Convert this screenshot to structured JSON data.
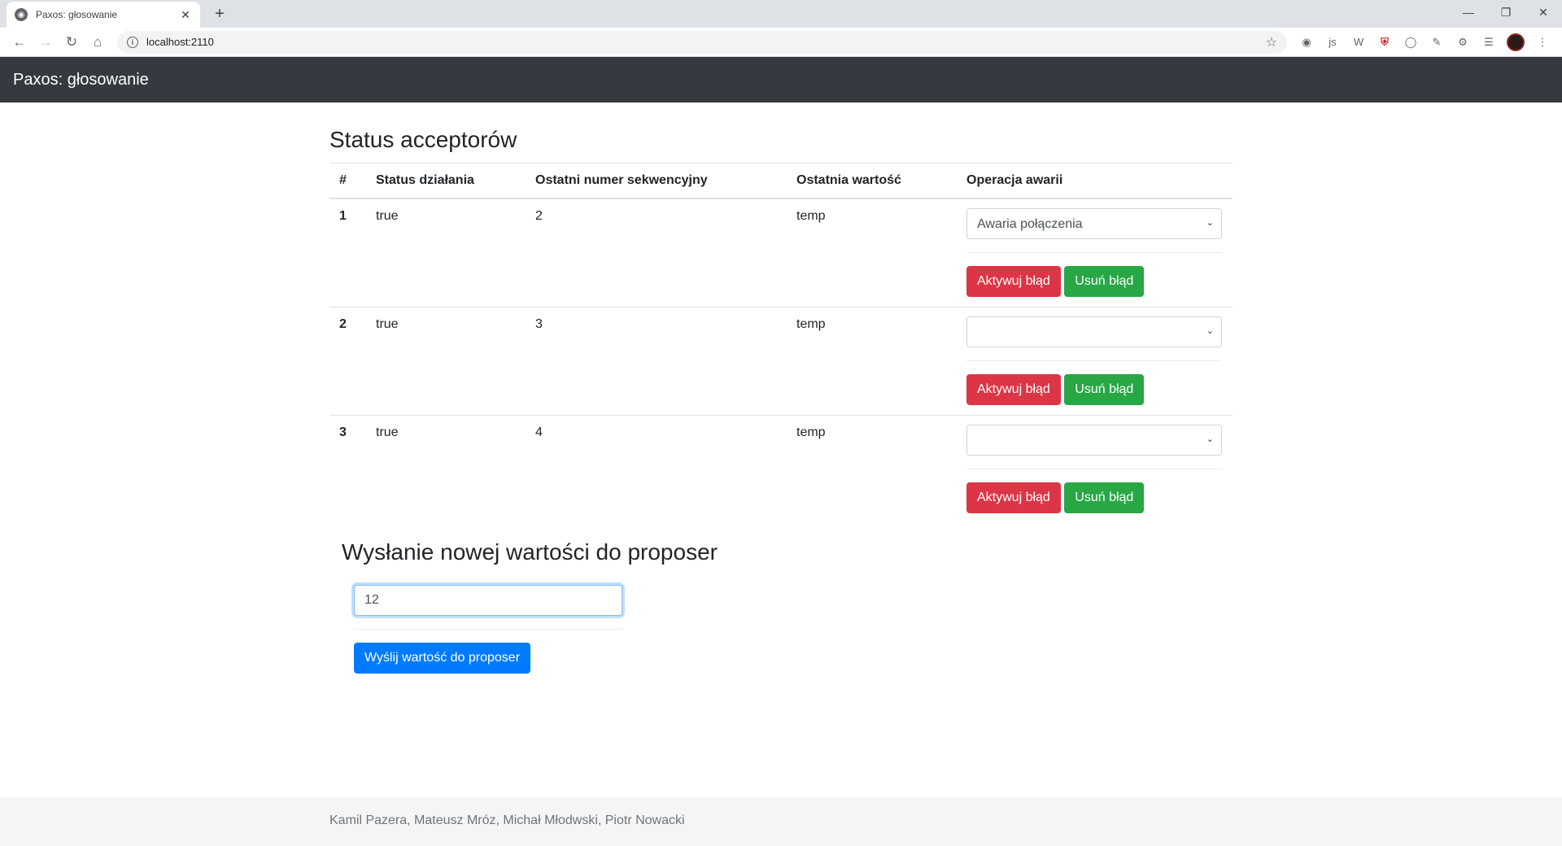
{
  "browser": {
    "tab_title": "Paxos: głosowanie",
    "url": "localhost:2110"
  },
  "navbar": {
    "brand": "Paxos: głosowanie"
  },
  "acceptors": {
    "title": "Status acceptorów",
    "headers": [
      "#",
      "Status działania",
      "Ostatni numer sekwencyjny",
      "Ostatnia wartość",
      "Operacja awarii"
    ],
    "rows": [
      {
        "num": "1",
        "status": "true",
        "seq": "2",
        "value": "temp",
        "failure": "Awaria połączenia"
      },
      {
        "num": "2",
        "status": "true",
        "seq": "3",
        "value": "temp",
        "failure": ""
      },
      {
        "num": "3",
        "status": "true",
        "seq": "4",
        "value": "temp",
        "failure": ""
      }
    ],
    "activate_label": "Aktywuj błąd",
    "remove_label": "Usuń błąd"
  },
  "send": {
    "title": "Wysłanie nowej wartości do proposer",
    "input_value": "12",
    "button_label": "Wyślij wartość do proposer"
  },
  "footer": {
    "authors": "Kamil Pazera, Mateusz Mróz, Michał Młodwski, Piotr Nowacki"
  },
  "colors": {
    "navbar": "#343a40",
    "danger": "#dc3545",
    "success": "#28a745",
    "primary": "#007bff"
  }
}
